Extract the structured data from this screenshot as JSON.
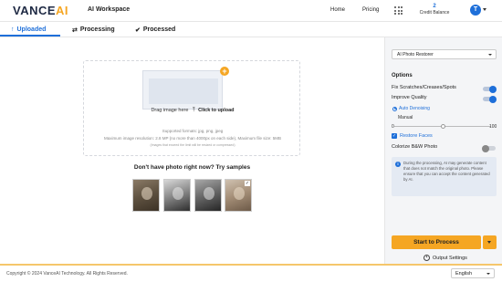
{
  "header": {
    "logo_part1": "VANCE",
    "logo_part2": "AI",
    "workspace_title": "AI Workspace",
    "nav": {
      "home": "Home",
      "pricing": "Pricing"
    },
    "credit_count": "2",
    "credit_label": "Credit Balance",
    "avatar_letter": "T"
  },
  "tabs": [
    {
      "label": "Uploaded",
      "icon": "upload-arrow-icon",
      "active": true
    },
    {
      "label": "Processing",
      "icon": "processing-icon",
      "active": false
    },
    {
      "label": "Processed",
      "icon": "check-circle-icon",
      "active": false
    }
  ],
  "upload": {
    "drag_text": "Drag image here",
    "click_text": "Click to upload",
    "formats": "Supported formats: jpg, png, jpeg",
    "resolution": "Maximum image resolution: 2.8 MP (no more than 4000px on each side), Maximum file size: 5MB",
    "note": "(Images that exceed the limit will be resized or compressed)"
  },
  "samples": {
    "title": "Don't have photo right now? Try samples",
    "count": 4
  },
  "settings": {
    "model_select": "AI Photo Restorer",
    "options_title": "Options",
    "fix_scratches": {
      "label": "Fix Scratches/Creases/Spots",
      "on": true
    },
    "improve_quality": {
      "label": "Improve Quality",
      "on": true
    },
    "auto_denoising": "Auto Denoising",
    "manual": "Manual",
    "slider": {
      "min": "0",
      "max": "100",
      "value_fraction": 0.5
    },
    "restore_faces": {
      "label": "Restore Faces",
      "checked": true
    },
    "colorize": {
      "label": "Colorize B&W Photo",
      "on": false
    },
    "info_text": "During the processing, AI may generate content that does not match the original photo. Please ensure that you can accept the content generated by AI.",
    "start_button": "Start to Process",
    "output_settings": "Output Settings"
  },
  "footer": {
    "copyright": "Copyright © 2024 VanceAI Technology. All Rights Reserved.",
    "language": "English"
  },
  "colors": {
    "accent_blue": "#1e6fd9",
    "accent_orange": "#f5a623"
  }
}
